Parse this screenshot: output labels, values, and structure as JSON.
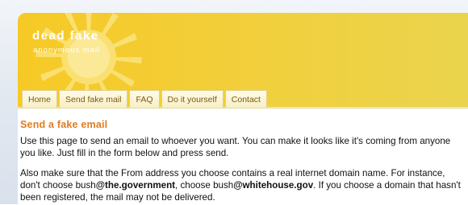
{
  "header": {
    "title": "dead fake",
    "subtitle": "anonymous mail"
  },
  "nav": {
    "tabs": [
      {
        "label": "Home"
      },
      {
        "label": "Send fake mail"
      },
      {
        "label": "FAQ"
      },
      {
        "label": "Do it yourself"
      },
      {
        "label": "Contact"
      }
    ]
  },
  "main": {
    "heading": "Send a fake email",
    "intro": "Use this page to send an email to whoever you want. You can make it looks like it's coming from anyone you like. Just fill in the form below and press send.",
    "note": {
      "part1": "Also make sure that the From address you choose contains a real internet domain name. For instance, don't choose bush",
      "bad_domain": "@the.government",
      "part2": ", choose bush",
      "good_domain": "@whitehouse.gov",
      "part3": ". If you choose a domain that hasn't been registered, the mail may not be delivered."
    }
  },
  "colors": {
    "banner": "#f3cd35",
    "heading": "#e07c20",
    "tab_text": "#7a5a10"
  },
  "icons": {
    "logo": "sun-icon"
  }
}
